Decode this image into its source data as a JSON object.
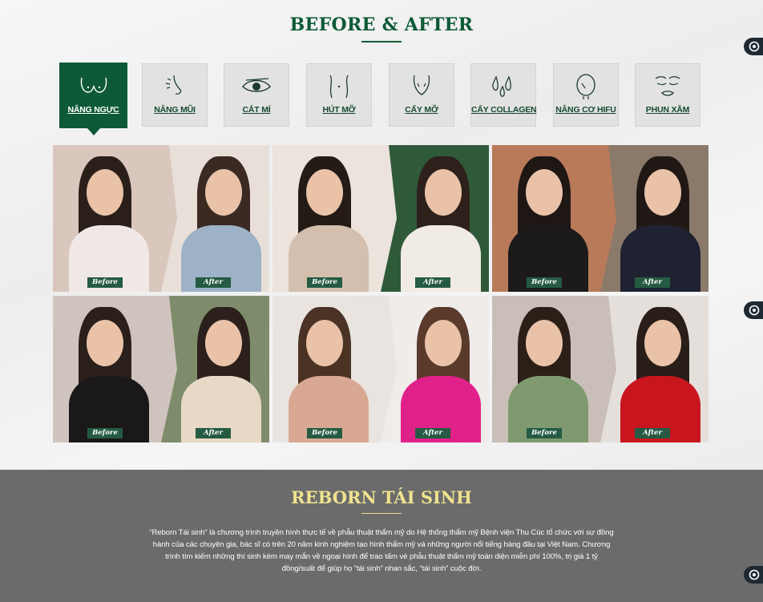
{
  "section": {
    "title": "BEFORE & AFTER"
  },
  "tabs": [
    {
      "label": "NÂNG NGỰC",
      "icon": "breast-icon",
      "active": true
    },
    {
      "label": "NÂNG MŨI",
      "icon": "nose-icon",
      "active": false
    },
    {
      "label": "CẮT MÍ",
      "icon": "eye-icon",
      "active": false
    },
    {
      "label": "HÚT MỠ",
      "icon": "body-contour-icon",
      "active": false
    },
    {
      "label": "CẤY MỠ",
      "icon": "face-fat-icon",
      "active": false
    },
    {
      "label": "CẤY COLLAGEN",
      "icon": "drops-icon",
      "active": false
    },
    {
      "label": "NÂNG CƠ HIFU",
      "icon": "face-lift-icon",
      "active": false
    },
    {
      "label": "PHUN XĂM",
      "icon": "brow-lips-icon",
      "active": false
    }
  ],
  "gallery": {
    "before_label": "Before",
    "after_label": "After",
    "items": [
      {
        "before": "Before",
        "after": "After"
      },
      {
        "before": "Before",
        "after": "After"
      },
      {
        "before": "Before",
        "after": "After"
      },
      {
        "before": "Before",
        "after": "After"
      },
      {
        "before": "Before",
        "after": "After"
      },
      {
        "before": "Before",
        "after": "After"
      }
    ]
  },
  "reborn": {
    "title": "REBORN TÁI SINH",
    "description": "“Reborn Tái sinh” là chương trình truyền hình thực tế về phẫu thuật thẩm mỹ do Hệ thống thẩm mỹ Bệnh viện Thu Cúc tổ chức với sự đồng hành của các chuyên gia, bác sĩ có trên 20 năm kinh nghiệm tạo hình thẩm mỹ và những người nổi tiếng hàng đầu tại Việt Nam. Chương trình tìm kiếm những thí sinh kém may mắn về ngoại hình để trao tấm vé phẫu thuật thẩm mỹ toàn diện miễn phí 100%, trị giá 1 tỷ đồng/suất để giúp họ “tái sinh” nhan sắc, “tái sinh” cuộc đời."
  },
  "colors": {
    "brand_green": "#0e5a36",
    "gold": "#efe38f",
    "dark_band": "#6b6b6b"
  },
  "floating_buttons": [
    "support-icon",
    "support-icon",
    "support-icon"
  ]
}
